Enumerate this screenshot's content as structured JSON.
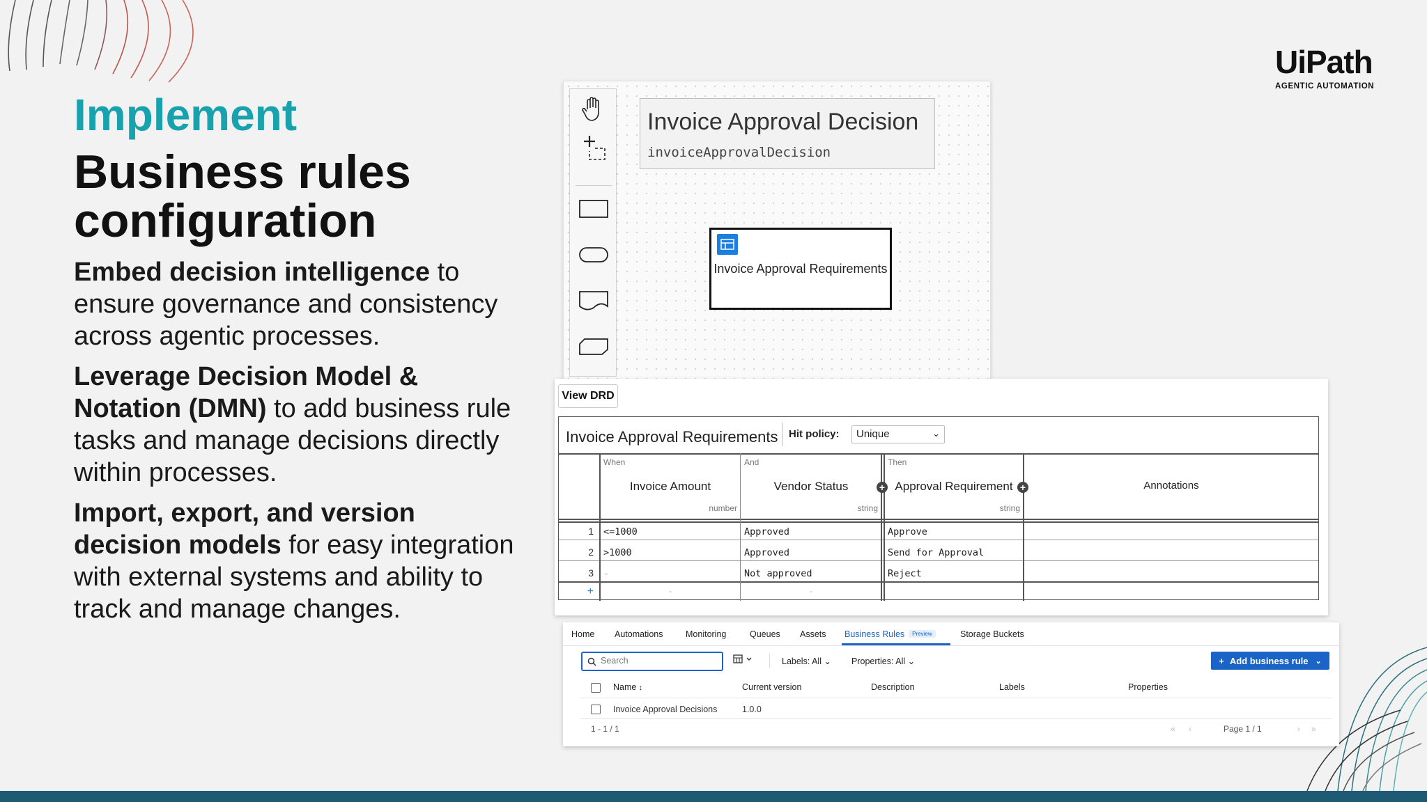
{
  "slide": {
    "eyebrow": "Implement",
    "title_line1": "Business rules",
    "title_line2": "configuration",
    "para1_bold": "Embed decision intelligence",
    "para1_rest": " to ensure governance and consistency across agentic processes.",
    "para2_bold": "Leverage Decision Model & Notation (DMN)",
    "para2_rest": " to add business rule tasks and manage decisions directly within processes.",
    "para3_bold": "Import, export, and version decision models",
    "para3_rest": " for easy integration with external systems and ability to track and manage changes."
  },
  "logo": {
    "word": "UiPath",
    "tagline": "AGENTIC AUTOMATION"
  },
  "drd": {
    "decision_title": "Invoice Approval Decision",
    "decision_id": "invoiceApprovalDecision",
    "node_label": "Invoice Approval Requirements",
    "palette_icons": [
      "hand-tool-icon",
      "lasso-select-icon",
      "decision-shape-icon",
      "input-data-shape-icon",
      "knowledge-source-shape-icon",
      "bkm-shape-icon"
    ]
  },
  "decision_table": {
    "view_drd": "View DRD",
    "name": "Invoice Approval Requirements",
    "hit_policy_label": "Hit policy:",
    "hit_policy_value": "Unique",
    "columns": [
      {
        "clause": "When",
        "label": "Invoice Amount",
        "type": "number"
      },
      {
        "clause": "And",
        "label": "Vendor Status",
        "type": "string"
      },
      {
        "clause": "Then",
        "label": "Approval Requirement",
        "type": "string"
      },
      {
        "clause": "",
        "label": "Annotations",
        "type": ""
      }
    ],
    "rows": [
      {
        "num": "1",
        "c1": "<=1000",
        "c2": "Approved",
        "c3": "Approve",
        "c4": ""
      },
      {
        "num": "2",
        "c1": ">1000",
        "c2": "Approved",
        "c3": "Send for Approval",
        "c4": ""
      },
      {
        "num": "3",
        "c1": "-",
        "c2": "Not approved",
        "c3": "Reject",
        "c4": ""
      }
    ],
    "add_row": "+",
    "empty_dash": "-"
  },
  "orchestrator": {
    "tabs": [
      "Home",
      "Automations",
      "Monitoring",
      "Queues",
      "Assets",
      "Business Rules",
      "Storage Buckets"
    ],
    "active_tab": "Business Rules",
    "preview_badge": "Preview",
    "search_placeholder": "Search",
    "labels_filter": "Labels: All",
    "properties_filter": "Properties: All",
    "add_button": "Add business rule",
    "columns": [
      "Name",
      "Current version",
      "Description",
      "Labels",
      "Properties"
    ],
    "rows": [
      {
        "name": "Invoice Approval Decisions",
        "version": "1.0.0",
        "description": "",
        "labels": "",
        "properties": ""
      }
    ],
    "range": "1 - 1 / 1",
    "page": "Page 1 / 1"
  },
  "colors": {
    "eyebrow": "#17a2ad",
    "accent_blue": "#1a64c8",
    "bottom_bar": "#1e5a73"
  }
}
